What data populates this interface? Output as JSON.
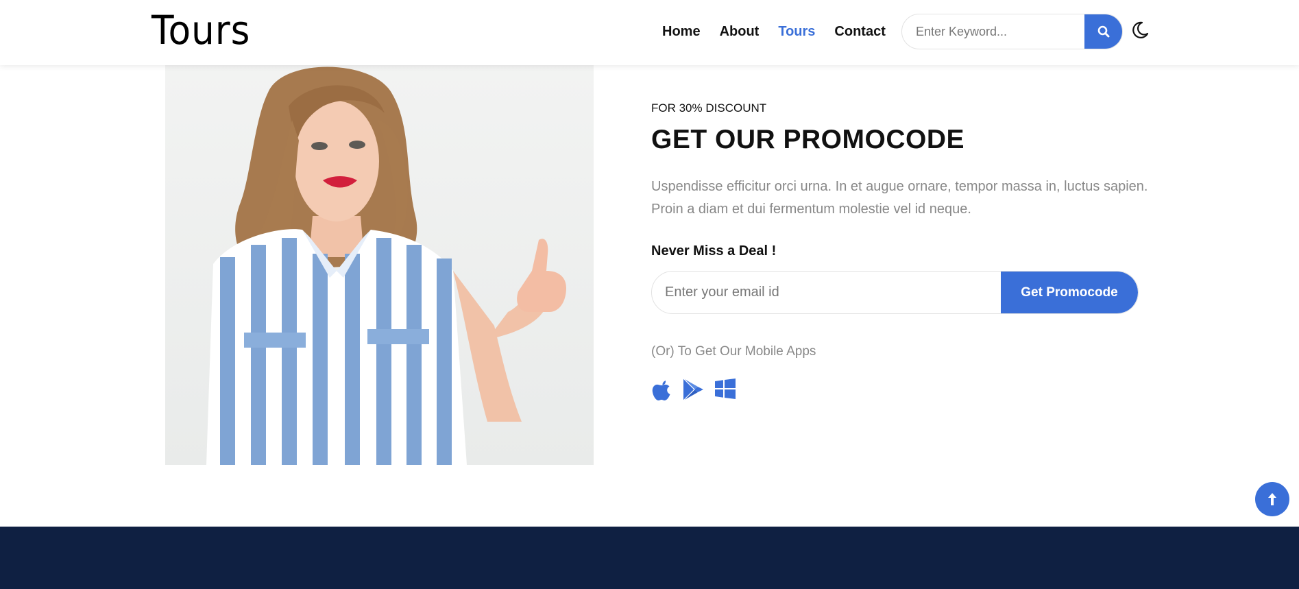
{
  "header": {
    "logo": "Tours",
    "nav": [
      {
        "label": "Home",
        "active": false
      },
      {
        "label": "About",
        "active": false
      },
      {
        "label": "Tours",
        "active": true
      },
      {
        "label": "Contact",
        "active": false
      }
    ],
    "search": {
      "placeholder": "Enter Keyword...",
      "value": ""
    },
    "search_icon": "search-icon",
    "theme_icon": "moon-icon"
  },
  "promo": {
    "eyebrow": "FOR 30% DISCOUNT",
    "title": "GET OUR PROMOCODE",
    "description": "Uspendisse efficitur orci urna. In et augue ornare, tempor massa in, luctus sapien. Proin a diam et dui fermentum molestie vel id neque.",
    "deal_heading": "Never Miss a Deal !",
    "email": {
      "placeholder": "Enter your email id",
      "value": ""
    },
    "button_label": "Get Promocode",
    "apps_text": "(Or) To Get Our Mobile Apps",
    "app_icons": [
      "apple-icon",
      "google-play-icon",
      "windows-icon"
    ]
  },
  "back_to_top_icon": "arrow-up-icon",
  "colors": {
    "accent": "#3a6fd8",
    "text": "#111111",
    "muted": "#888888",
    "footer": "#0f2042"
  }
}
